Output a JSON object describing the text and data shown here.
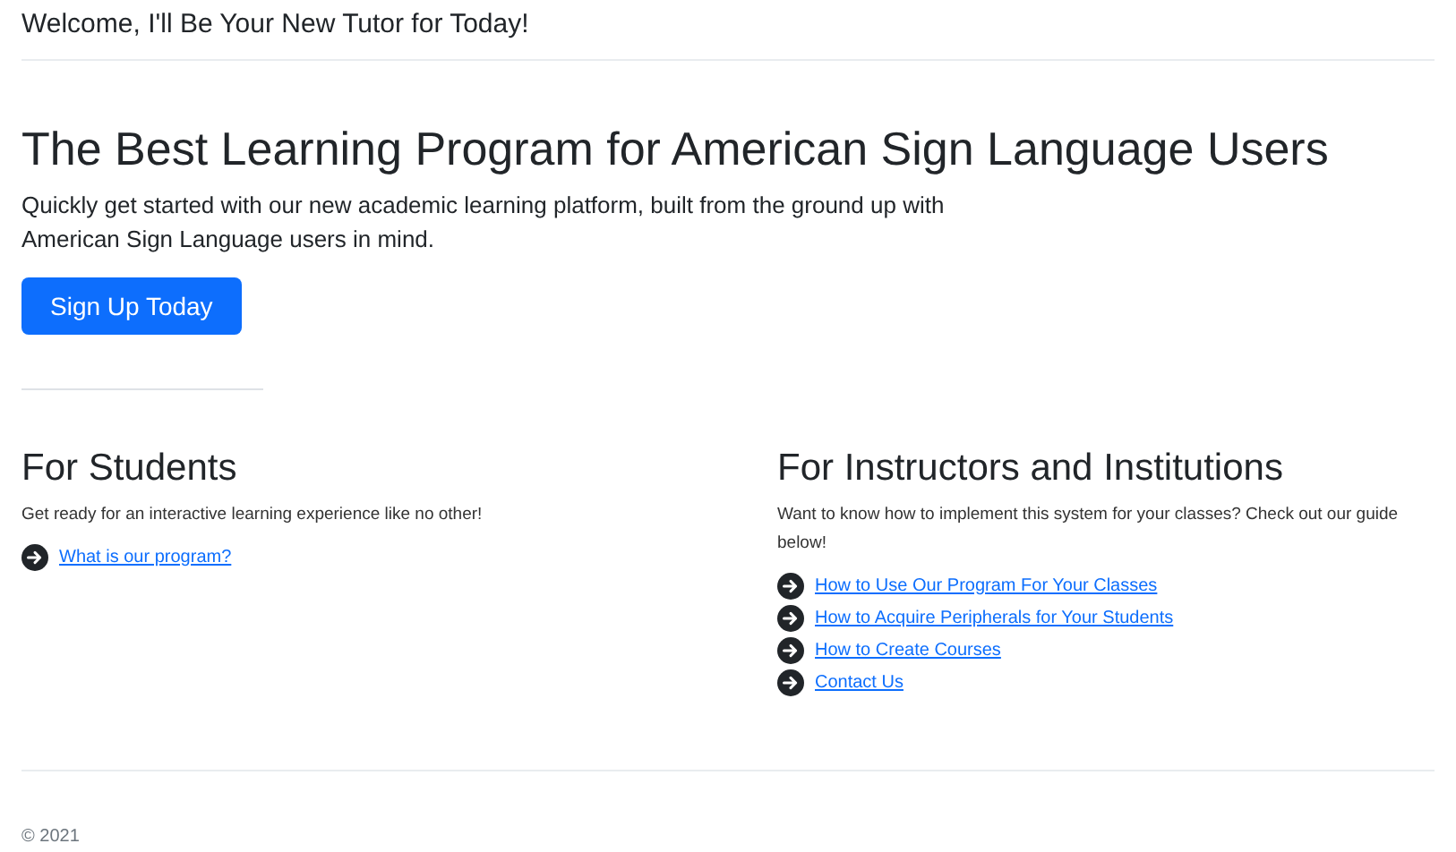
{
  "header": {
    "title": "Welcome, I'll Be Your New Tutor for Today!"
  },
  "hero": {
    "heading": "The Best Learning Program for American Sign Language Users",
    "lead": "Quickly get started with our new academic learning platform, built from the ground up with American Sign Language users in mind.",
    "button": "Sign Up Today"
  },
  "columns": [
    {
      "heading": "For Students",
      "text": "Get ready for an interactive learning experience like no other!",
      "links": [
        "What is our program?"
      ]
    },
    {
      "heading": "For Instructors and Institutions",
      "text": "Want to know how to implement this system for your classes? Check out our guide below!",
      "links": [
        "How to Use Our Program For Your Classes",
        "How to Acquire Peripherals for Your Students",
        "How to Create Courses",
        "Contact Us"
      ]
    }
  ],
  "footer": {
    "text": "© 2021"
  }
}
